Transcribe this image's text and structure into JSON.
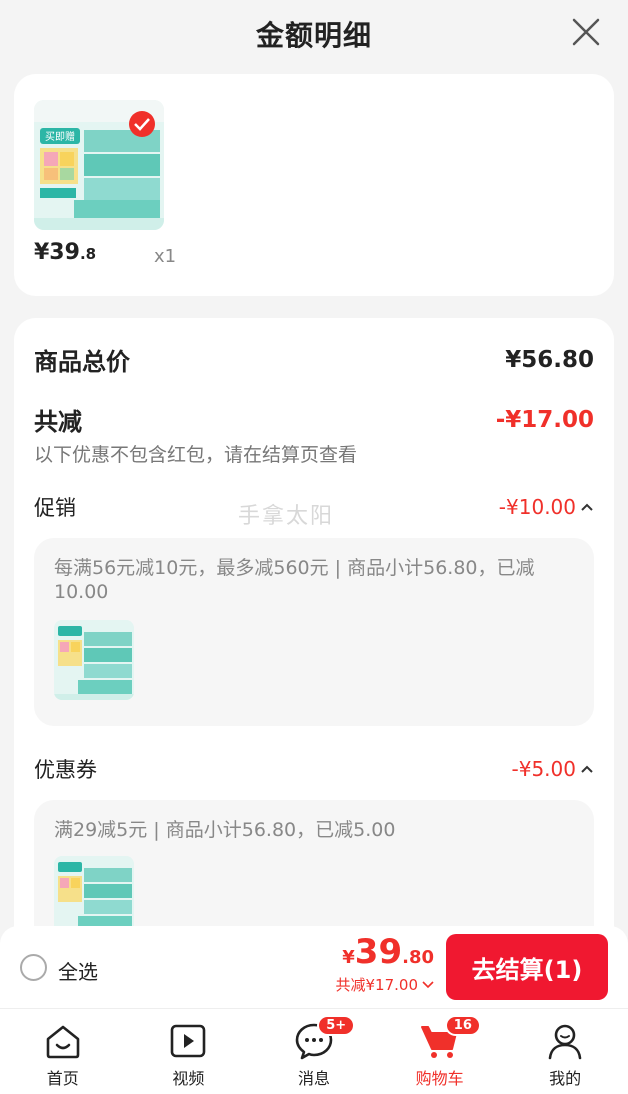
{
  "header": {
    "title": "金额明细"
  },
  "product": {
    "price_int": "¥39",
    "price_dec": ".8",
    "qty": "x1",
    "thumb_text": "买即赠"
  },
  "summary": {
    "total_label": "商品总价",
    "total_value": "¥56.80",
    "discount_label": "共减",
    "discount_value": "-¥17.00",
    "note": "以下优惠不包含红包，请在结算页查看",
    "watermark": "手拿太阳"
  },
  "promo": {
    "label": "促销",
    "value": "-¥10.00",
    "desc": "每满56元减10元，最多减560元 | 商品小计56.80，已减10.00"
  },
  "coupon": {
    "label": "优惠券",
    "value": "-¥5.00",
    "desc": "满29减5元 | 商品小计56.80，已减5.00"
  },
  "bottom": {
    "select_all": "全选",
    "price_symbol": "¥",
    "price_int": "39",
    "price_dec": ".80",
    "saved": "共减¥17.00",
    "checkout": "去结算(1)"
  },
  "tabs": [
    {
      "label": "首页",
      "icon": "home-icon"
    },
    {
      "label": "视频",
      "icon": "video-icon"
    },
    {
      "label": "消息",
      "icon": "message-icon",
      "badge": "5+"
    },
    {
      "label": "购物车",
      "icon": "cart-icon",
      "badge": "16",
      "active": true
    },
    {
      "label": "我的",
      "icon": "profile-icon"
    }
  ],
  "colors": {
    "accent": "#f0302a",
    "button": "#f01830"
  }
}
